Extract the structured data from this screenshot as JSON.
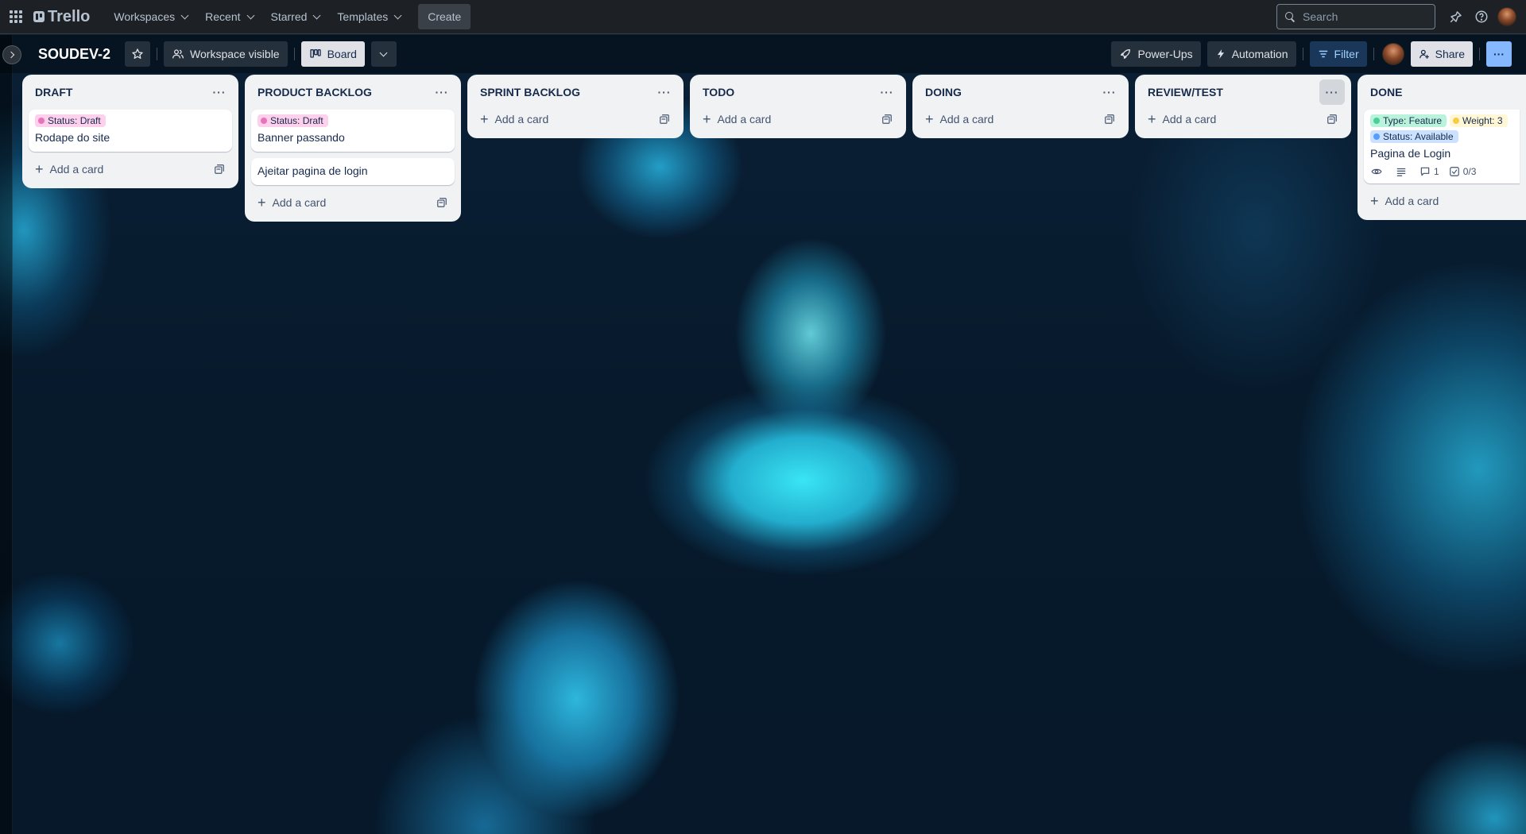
{
  "topnav": {
    "logo_text": "Trello",
    "menus": [
      {
        "label": "Workspaces"
      },
      {
        "label": "Recent"
      },
      {
        "label": "Starred"
      },
      {
        "label": "Templates"
      }
    ],
    "create_label": "Create",
    "search_placeholder": "Search",
    "icons": [
      "apps-grid-icon",
      "trello-logo-icon",
      "search-icon",
      "notifications-bell-icon",
      "help-icon",
      "user-avatar"
    ]
  },
  "board_header": {
    "title": "SOUDEV-2",
    "visibility_label": "Workspace visible",
    "view_label": "Board",
    "powerups_label": "Power-Ups",
    "automation_label": "Automation",
    "filter_label": "Filter",
    "share_label": "Share"
  },
  "lists": [
    {
      "title": "DRAFT",
      "cards": [
        {
          "labels": [
            {
              "text": "Status: Draft",
              "color": "#fdd0ec",
              "dot": "#e774bb"
            }
          ],
          "title": "Rodape do site"
        }
      ],
      "add_label": "Add a card"
    },
    {
      "title": "PRODUCT BACKLOG",
      "cards": [
        {
          "labels": [
            {
              "text": "Status: Draft",
              "color": "#fdd0ec",
              "dot": "#e774bb"
            }
          ],
          "title": "Banner passando"
        },
        {
          "labels": [],
          "title": "Ajeitar pagina de login"
        }
      ],
      "add_label": "Add a card"
    },
    {
      "title": "SPRINT BACKLOG",
      "cards": [],
      "add_label": "Add a card"
    },
    {
      "title": "TODO",
      "cards": [],
      "add_label": "Add a card"
    },
    {
      "title": "DOING",
      "cards": [],
      "add_label": "Add a card"
    },
    {
      "title": "REVIEW/TEST",
      "cards": [],
      "add_label": "Add a card"
    },
    {
      "title": "DONE",
      "cards": [
        {
          "labels": [
            {
              "text": "Type: Feature",
              "color": "#baf3db",
              "dot": "#4bce97"
            },
            {
              "text": "Weight: 3",
              "color": "#fff7d6",
              "dot": "#f5cd47"
            },
            {
              "text": "Status: Available",
              "color": "#cce0ff",
              "dot": "#579dff"
            }
          ],
          "title": "Pagina de Login",
          "badges": {
            "comments": "1",
            "checklist": "0/3"
          }
        }
      ],
      "add_label": "Add a card"
    }
  ]
}
